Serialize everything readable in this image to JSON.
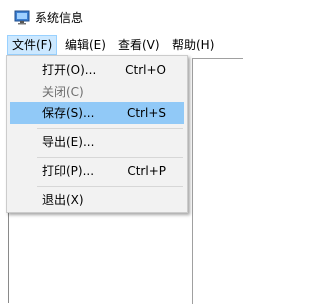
{
  "window": {
    "title": "系统信息",
    "icon": "system-info-monitor-icon"
  },
  "menubar": {
    "file": "文件(F)",
    "edit": "编辑(E)",
    "view": "查看(V)",
    "help": "帮助(H)"
  },
  "file_menu": {
    "open": {
      "label": "打开(O)...",
      "shortcut": "Ctrl+O"
    },
    "close": {
      "label": "关闭(C)"
    },
    "save": {
      "label": "保存(S)...",
      "shortcut": "Ctrl+S"
    },
    "export": {
      "label": "导出(E)..."
    },
    "print": {
      "label": "打印(P)...",
      "shortcut": "Ctrl+P"
    },
    "exit": {
      "label": "退出(X)"
    }
  },
  "colors": {
    "menu_background": "#f2f2f2",
    "highlight": "#91c9f7",
    "active_menu_header": "#cce8ff",
    "disabled_text": "#6d6d6d"
  }
}
